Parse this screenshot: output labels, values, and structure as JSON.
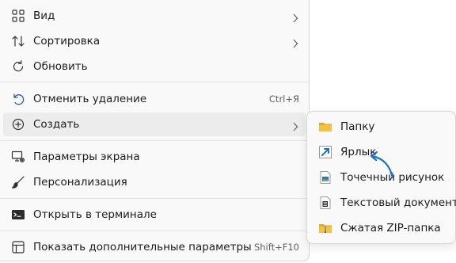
{
  "context_menu": {
    "items": [
      {
        "label": "Вид",
        "icon": "grid-view-icon",
        "has_submenu": true
      },
      {
        "label": "Сортировка",
        "icon": "sort-arrows-icon",
        "has_submenu": true
      },
      {
        "label": "Обновить",
        "icon": "refresh-icon",
        "has_submenu": false
      },
      {
        "label": "Отменить удаление",
        "icon": "undo-icon",
        "shortcut": "Ctrl+Я"
      },
      {
        "label": "Создать",
        "icon": "plus-circle-icon",
        "has_submenu": true
      },
      {
        "label": "Параметры экрана",
        "icon": "display-settings-icon"
      },
      {
        "label": "Персонализация",
        "icon": "paintbrush-icon"
      },
      {
        "label": "Открыть в терминале",
        "icon": "terminal-icon"
      },
      {
        "label": "Показать дополнительные параметры",
        "icon": "more-options-icon",
        "shortcut": "Shift+F10"
      }
    ]
  },
  "submenu_create": {
    "items": [
      {
        "label": "Папку",
        "icon": "folder-icon"
      },
      {
        "label": "Ярлык",
        "icon": "shortcut-icon"
      },
      {
        "label": "Точечный рисунок",
        "icon": "bitmap-image-icon"
      },
      {
        "label": "Текстовый документ",
        "icon": "text-document-icon"
      },
      {
        "label": "Сжатая ZIP-папка",
        "icon": "zip-folder-icon"
      }
    ]
  },
  "colors": {
    "accent": "#1a73c8",
    "menu_bg": "#f9f9f9",
    "hover_bg": "#ececec",
    "folder": "#f5c342"
  }
}
